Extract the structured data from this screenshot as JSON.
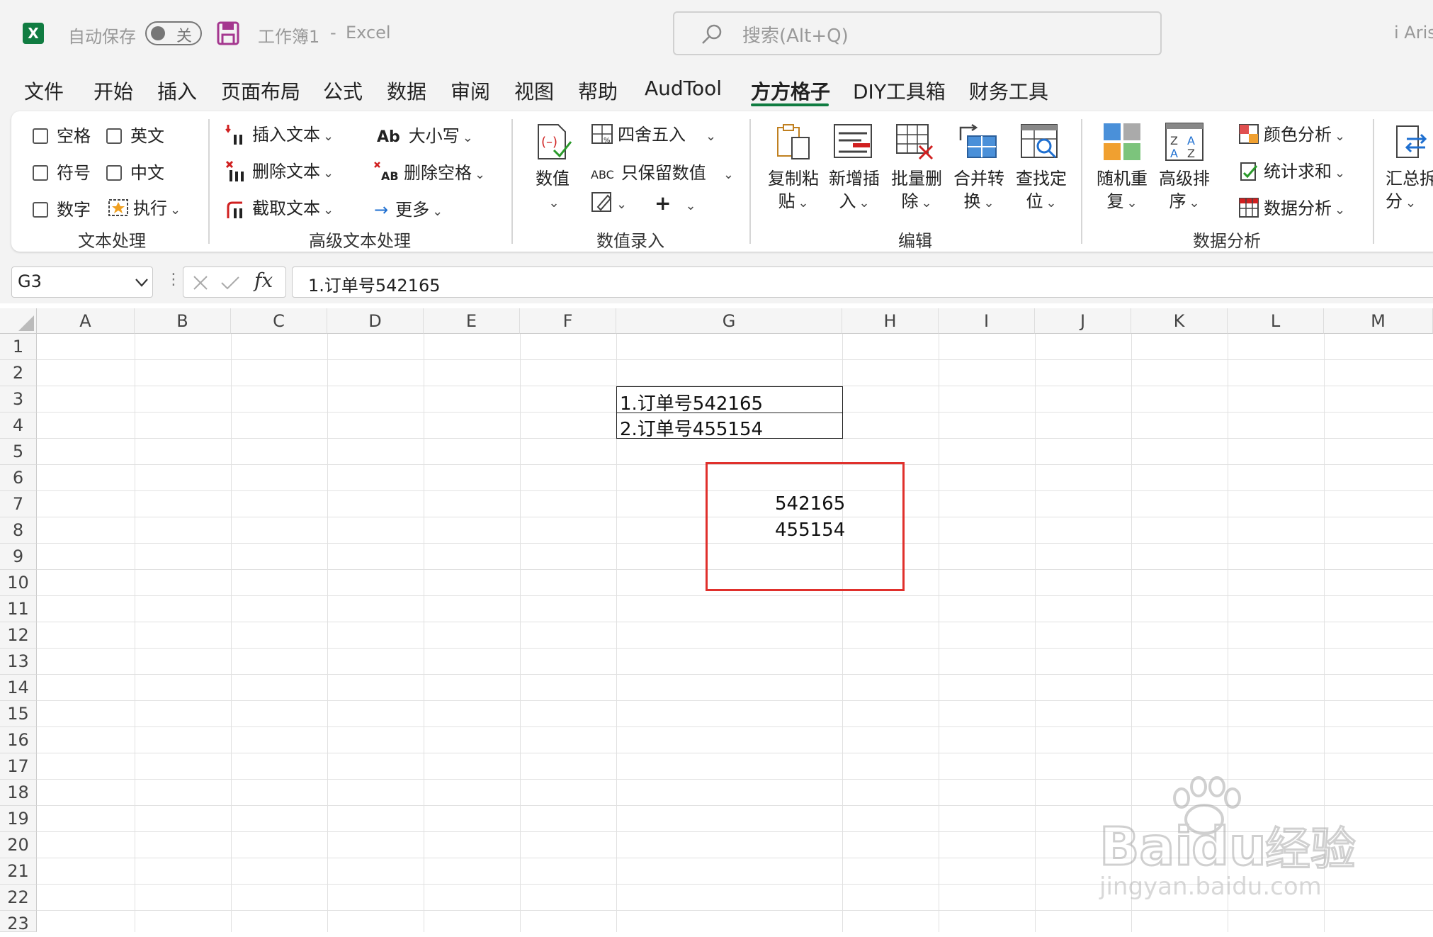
{
  "titlebar": {
    "autosave_label": "自动保存",
    "autosave_state": "关",
    "doc_title": "工作簿1",
    "separator": "-",
    "app_name": "Excel",
    "search_placeholder": "搜索(Alt+Q)",
    "user": "i Aris"
  },
  "menu": [
    "文件",
    "开始",
    "插入",
    "页面布局",
    "公式",
    "数据",
    "审阅",
    "视图",
    "帮助",
    "AudTool",
    "方方格子",
    "DIY工具箱",
    "财务工具"
  ],
  "ribbon": {
    "text_group": {
      "name": "文本处理",
      "space": "空格",
      "english": "英文",
      "symbol": "符号",
      "chinese": "中文",
      "digit": "数字",
      "execute": "执行"
    },
    "adv_text_group": {
      "name": "高级文本处理",
      "insert_text": "插入文本",
      "delete_text": "删除文本",
      "cut_text": "截取文本",
      "case": "大小写",
      "case_icon": "Ab",
      "del_space": "删除空格",
      "more": "更多"
    },
    "num_group": {
      "name": "数值录入",
      "value": "数值",
      "round": "四舍五入",
      "keep_value": "只保留数值",
      "abc": "ABC"
    },
    "edit_group": {
      "name": "编辑",
      "copy_paste": [
        "复制粘",
        "贴"
      ],
      "new_insert": [
        "新增插",
        "入"
      ],
      "batch_delete": [
        "批量删",
        "除"
      ],
      "merge_convert": [
        "合并转",
        "换"
      ],
      "find_locate": [
        "查找定",
        "位"
      ]
    },
    "analysis_group": {
      "name": "数据分析",
      "random_repeat": [
        "随机重",
        "复"
      ],
      "advanced_sort": [
        "高级排",
        "序"
      ],
      "color_analysis": "颜色分析",
      "stat_sum": "统计求和",
      "data_analysis": "数据分析"
    },
    "summary": [
      "汇总拆",
      "分"
    ]
  },
  "formula_bar": {
    "name_box": "G3",
    "fx": "fx",
    "value": "1.订单号542165"
  },
  "sheet": {
    "columns": [
      "A",
      "B",
      "C",
      "D",
      "E",
      "F",
      "G",
      "H",
      "I",
      "J",
      "K",
      "L",
      "M"
    ],
    "rows": [
      "1",
      "2",
      "3",
      "4",
      "5",
      "6",
      "7",
      "8",
      "9",
      "10",
      "11",
      "12",
      "13",
      "14",
      "15",
      "16",
      "17",
      "18",
      "19",
      "20",
      "21",
      "22",
      "23"
    ],
    "g3": "1.订单号542165",
    "g4": "2.订单号455154",
    "result1": "542165",
    "result2": "455154"
  },
  "watermark": {
    "brand": "Bai",
    "brand2": "du",
    "cn": "经验",
    "url": "jingyan.baidu.com"
  },
  "colors": {
    "excel_green": "#107c41",
    "highlight_red": "#e0302c",
    "save_purple": "#a4378f"
  }
}
